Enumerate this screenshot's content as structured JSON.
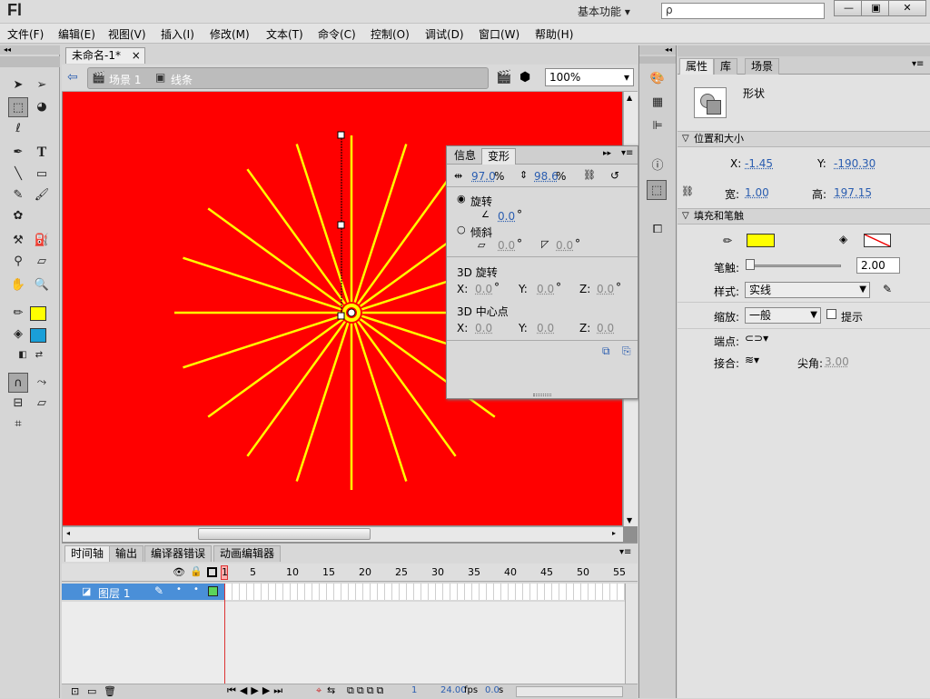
{
  "app": {
    "logo": "Fl",
    "workspace": "基本功能",
    "search_placeholder": "ρ"
  },
  "window_buttons": [
    "—",
    "▣",
    "✕"
  ],
  "menu": [
    "文件(F)",
    "编辑(E)",
    "视图(V)",
    "插入(I)",
    "修改(M)",
    "文本(T)",
    "命令(C)",
    "控制(O)",
    "调试(D)",
    "窗口(W)",
    "帮助(H)"
  ],
  "document": {
    "tab": "未命名-1*",
    "close": "×"
  },
  "breadcrumb": {
    "scene": "场景 1",
    "symbol": "线条"
  },
  "zoom": "100%",
  "transform_panel": {
    "tabs": [
      "信息",
      "变形"
    ],
    "width_pct": "97.0",
    "height_pct": "98.6",
    "pct": "%",
    "rotate_label": "旋转",
    "rotate_val": "0.0",
    "deg": "°",
    "skew_label": "倾斜",
    "skew_h": "0.0",
    "skew_v": "0.0",
    "rot3d_label": "3D 旋转",
    "rx": "0.0",
    "ry": "0.0",
    "rz": "0.0",
    "center3d_label": "3D 中心点",
    "cx": "0.0",
    "cy": "0.0",
    "cz": "0.0",
    "x": "X:",
    "y": "Y:",
    "z": "Z:"
  },
  "timeline": {
    "tabs": [
      "时间轴",
      "输出",
      "编译器错误",
      "动画编辑器"
    ],
    "frames": [
      "1",
      "5",
      "10",
      "15",
      "20",
      "25",
      "30",
      "35",
      "40",
      "45",
      "50",
      "55"
    ],
    "layer_name": "图层 1",
    "current_frame": "1",
    "fps": "24.00",
    "fps_unit": "fps",
    "time": "0.0",
    "time_unit": "s"
  },
  "properties": {
    "tabs": [
      "属性",
      "库",
      "场景"
    ],
    "shape_label": "形状",
    "pos_size": "位置和大小",
    "x_label": "X:",
    "x_val": "-1.45",
    "y_label": "Y:",
    "y_val": "-190.30",
    "w_label": "宽:",
    "w_val": "1.00",
    "h_label": "高:",
    "h_val": "197.15",
    "fill_stroke": "填充和笔触",
    "stroke_label": "笔触:",
    "stroke_val": "2.00",
    "style_label": "样式:",
    "style_val": "实线",
    "scale_label": "缩放:",
    "scale_val": "一般",
    "hint_label": "提示",
    "cap_label": "端点:",
    "join_label": "接合:",
    "miter_label": "尖角:",
    "miter_val": "3.00"
  },
  "colors": {
    "stage": "#ff0000",
    "stroke_color": "#ffff00",
    "fill_none": "#ffffff",
    "tool_fill": "#1a9fd8",
    "layer_sel": "#4a8fd8"
  }
}
